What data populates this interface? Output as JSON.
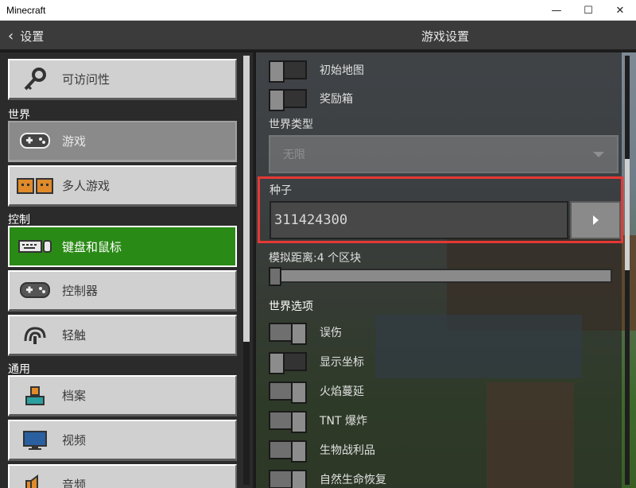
{
  "window": {
    "title": "Minecraft",
    "minimize_glyph": "—",
    "maximize_glyph": "☐",
    "close_glyph": "✕"
  },
  "header": {
    "back_label": "设置",
    "title": "游戏设置"
  },
  "sidebar": {
    "items": [
      {
        "label": "可访问性",
        "icon": "key-icon"
      },
      {
        "label": "游戏",
        "icon": "controller-icon",
        "state": "selected"
      },
      {
        "label": "多人游戏",
        "icon": "multiplayer-icon"
      },
      {
        "label": "键盘和鼠标",
        "icon": "keyboard-mouse-icon",
        "state": "active"
      },
      {
        "label": "控制器",
        "icon": "controller-icon"
      },
      {
        "label": "轻触",
        "icon": "touch-icon"
      },
      {
        "label": "档案",
        "icon": "profile-icon"
      },
      {
        "label": "视频",
        "icon": "video-icon"
      },
      {
        "label": "音频",
        "icon": "audio-icon"
      }
    ],
    "sections": {
      "world": "世界",
      "controls": "控制",
      "general": "通用"
    }
  },
  "settings": {
    "starting_map": {
      "label": "初始地图",
      "on": false
    },
    "bonus_chest": {
      "label": "奖励箱",
      "on": false
    },
    "world_type": {
      "label": "世界类型",
      "value": "无限"
    },
    "seed": {
      "label": "种子",
      "value": "311424300"
    },
    "sim_distance": {
      "label": "模拟距离:4 个区块",
      "value": 4
    },
    "world_options_title": "世界选项",
    "world_options": [
      {
        "label": "误伤",
        "on": true
      },
      {
        "label": "显示坐标",
        "on": false
      },
      {
        "label": "火焰蔓延",
        "on": true
      },
      {
        "label": "TNT 爆炸",
        "on": true
      },
      {
        "label": "生物战利品",
        "on": true
      },
      {
        "label": "自然生命恢复",
        "on": true
      }
    ]
  },
  "colors": {
    "active_green": "#2a8a16",
    "highlight_red": "#e53935"
  }
}
